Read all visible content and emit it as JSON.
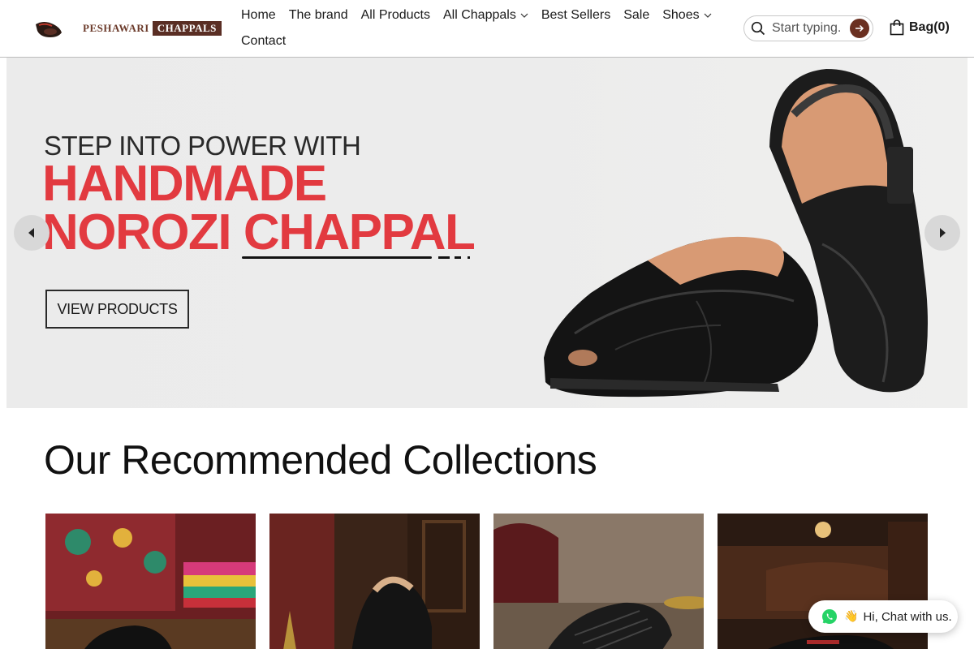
{
  "brand": {
    "word1": "PESHAWARI",
    "word2": "CHAPPALS"
  },
  "nav": {
    "items": [
      {
        "label": "Home"
      },
      {
        "label": "The brand"
      },
      {
        "label": "All Products"
      },
      {
        "label": "All Chappals",
        "has_dropdown": true
      },
      {
        "label": "Best Sellers"
      },
      {
        "label": "Sale"
      },
      {
        "label": "Shoes",
        "has_dropdown": true
      },
      {
        "label": "Contact"
      }
    ]
  },
  "search": {
    "placeholder": "Start typing."
  },
  "bag": {
    "label": "Bag(0)"
  },
  "hero": {
    "subtitle": "STEP INTO POWER WITH",
    "line1": "HANDMADE",
    "line2": "NOROZI CHAPPAL",
    "cta": "VIEW PRODUCTS"
  },
  "collections": {
    "title": "Our Recommended Collections",
    "cards": [
      {
        "name": "collection-1"
      },
      {
        "name": "collection-2"
      },
      {
        "name": "collection-3"
      },
      {
        "name": "collection-4"
      }
    ]
  },
  "chat": {
    "wave": "👋",
    "text": "Hi, Chat with us."
  },
  "colors": {
    "accent_red": "#e23a40",
    "brand_brown": "#6a2f20"
  },
  "icons": {
    "search": "search-icon",
    "search_go": "arrow-right-icon",
    "bag": "shopping-bag-icon",
    "prev": "chevron-left-icon",
    "next": "chevron-right-icon",
    "chat": "whatsapp-icon"
  }
}
